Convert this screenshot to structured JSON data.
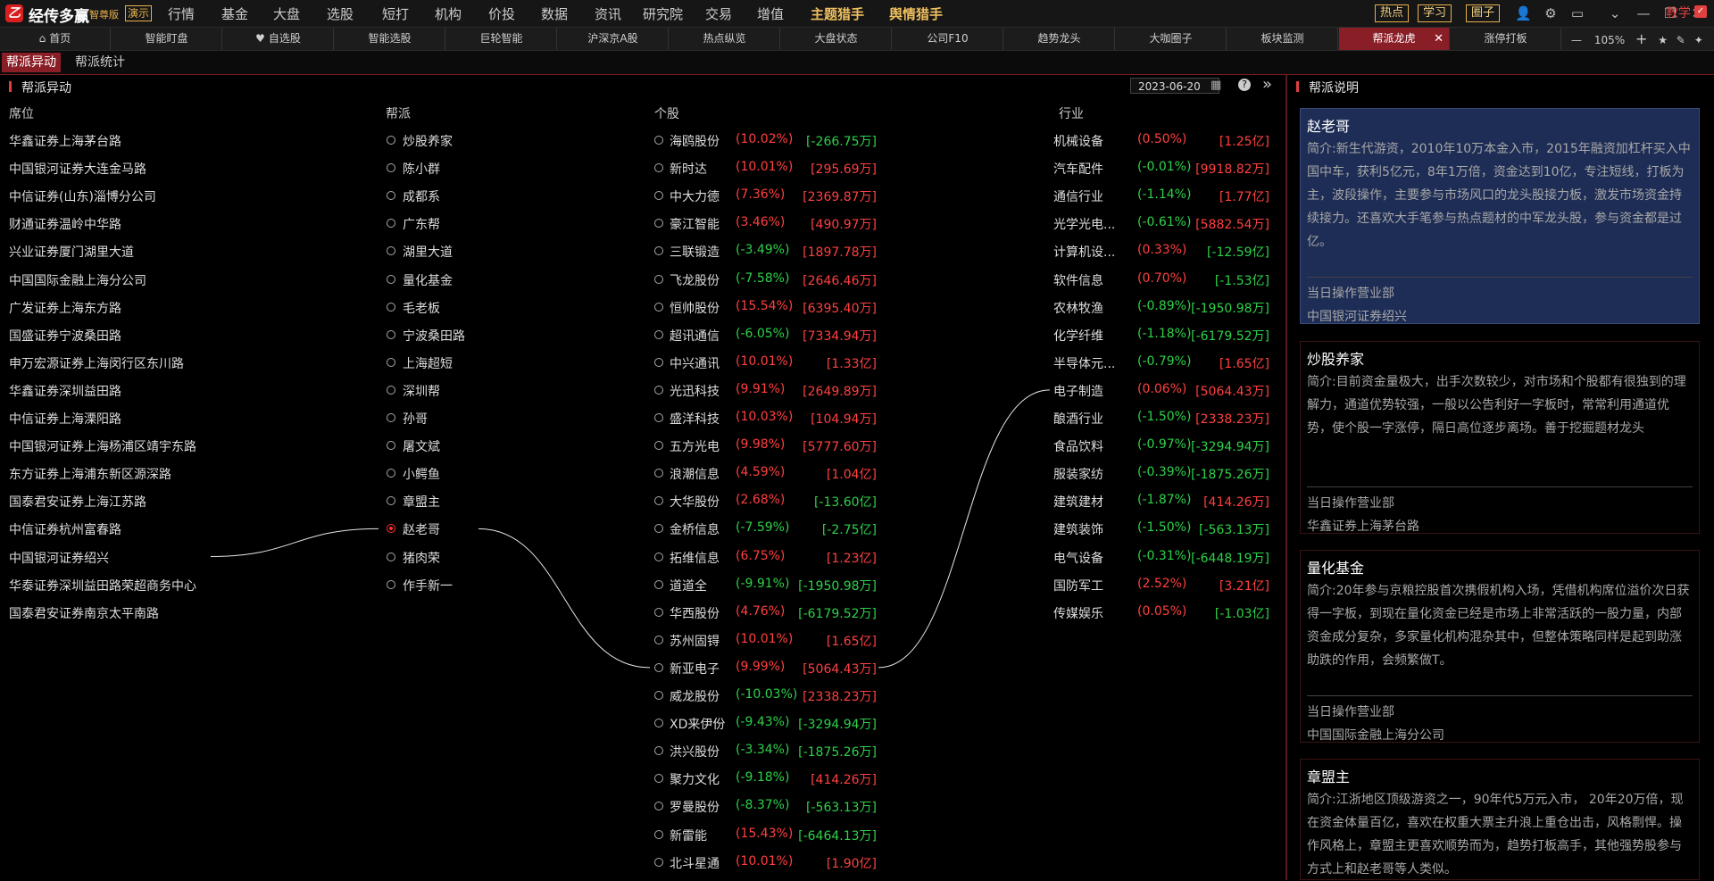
{
  "app": {
    "name": "经传多赢",
    "edition": "智尊版",
    "demo_badge": "演示",
    "menu": [
      {
        "label": "行情",
        "dot": true
      },
      {
        "label": "基金",
        "dot": false
      },
      {
        "label": "大盘",
        "dot": false
      },
      {
        "label": "选股",
        "dot": false
      },
      {
        "label": "短打",
        "dot": false
      },
      {
        "label": "机构",
        "dot": false
      },
      {
        "label": "价投",
        "dot": false
      },
      {
        "label": "数据",
        "dot": false
      },
      {
        "label": "资讯",
        "dot": false
      },
      {
        "label": "研究院",
        "dot": false
      },
      {
        "label": "交易",
        "dot": false
      },
      {
        "label": "增值",
        "dot": true
      },
      {
        "label": "主题猎手",
        "dot": true,
        "gold": true
      },
      {
        "label": "舆情猎手",
        "dot": true,
        "gold": true
      }
    ],
    "right_buttons": [
      "热点",
      "学习",
      "圈子"
    ]
  },
  "tabs": [
    {
      "label": "首页",
      "icon": "home-icon"
    },
    {
      "label": "智能盯盘"
    },
    {
      "label": "自选股",
      "icon": "heart-icon"
    },
    {
      "label": "智能选股"
    },
    {
      "label": "巨轮智能"
    },
    {
      "label": "沪深京A股"
    },
    {
      "label": "热点纵览"
    },
    {
      "label": "大盘状态"
    },
    {
      "label": "公司F10"
    },
    {
      "label": "趋势龙头"
    },
    {
      "label": "大咖圈子"
    },
    {
      "label": "板块监测"
    },
    {
      "label": "帮派龙虎",
      "active": true
    },
    {
      "label": "涨停打板"
    }
  ],
  "zoom": {
    "minus": "—",
    "value": "105%",
    "plus": "+"
  },
  "subtabs": [
    {
      "label": "帮派异动",
      "active": true
    },
    {
      "label": "帮派统计"
    }
  ],
  "teach_label": "教学",
  "left_panel": {
    "title": "帮派异动",
    "date": "2023-06-20",
    "headers": {
      "seat": "席位",
      "gang": "帮派",
      "stock": "个股",
      "industry": "行业"
    }
  },
  "seats": [
    "华鑫证券上海茅台路",
    "中国银河证券大连金马路",
    "中信证券(山东)淄博分公司",
    "财通证券温岭中华路",
    "兴业证券厦门湖里大道",
    "中国国际金融上海分公司",
    "广发证券上海东方路",
    "国盛证券宁波桑田路",
    "申万宏源证券上海闵行区东川路",
    "华鑫证券深圳益田路",
    "中信证券上海溧阳路",
    "中国银河证券上海杨浦区靖宇东路",
    "东方证券上海浦东新区源深路",
    "国泰君安证券上海江苏路",
    "中信证券杭州富春路",
    "中国银河证券绍兴",
    "华泰证券深圳益田路荣超商务中心",
    "国泰君安证券南京太平南路"
  ],
  "gangs": [
    {
      "name": "炒股养家",
      "selected": false
    },
    {
      "name": "陈小群",
      "selected": false
    },
    {
      "name": "成都系",
      "selected": false
    },
    {
      "name": "广东帮",
      "selected": false
    },
    {
      "name": "湖里大道",
      "selected": false
    },
    {
      "name": "量化基金",
      "selected": false
    },
    {
      "name": "毛老板",
      "selected": false
    },
    {
      "name": "宁波桑田路",
      "selected": false
    },
    {
      "name": "上海超短",
      "selected": false
    },
    {
      "name": "深圳帮",
      "selected": false
    },
    {
      "name": "孙哥",
      "selected": false
    },
    {
      "name": "屠文斌",
      "selected": false
    },
    {
      "name": "小鳄鱼",
      "selected": false
    },
    {
      "name": "章盟主",
      "selected": false
    },
    {
      "name": "赵老哥",
      "selected": true
    },
    {
      "name": "猪肉荣",
      "selected": false
    },
    {
      "name": "作手新一",
      "selected": false
    }
  ],
  "stocks": [
    {
      "name": "海鸥股份",
      "pct": "(10.02%)",
      "amt": "[-266.75万]",
      "pc": "red",
      "ac": "green"
    },
    {
      "name": "新时达",
      "pct": "(10.01%)",
      "amt": "[295.69万]",
      "pc": "red",
      "ac": "red"
    },
    {
      "name": "中大力德",
      "pct": "(7.36%)",
      "amt": "[2369.87万]",
      "pc": "red",
      "ac": "red"
    },
    {
      "name": "豪江智能",
      "pct": "(3.46%)",
      "amt": "[490.97万]",
      "pc": "red",
      "ac": "red"
    },
    {
      "name": "三联锻造",
      "pct": "(-3.49%)",
      "amt": "[1897.78万]",
      "pc": "green",
      "ac": "red"
    },
    {
      "name": "飞龙股份",
      "pct": "(-7.58%)",
      "amt": "[2646.46万]",
      "pc": "green",
      "ac": "red"
    },
    {
      "name": "恒帅股份",
      "pct": "(15.54%)",
      "amt": "[6395.40万]",
      "pc": "red",
      "ac": "red"
    },
    {
      "name": "超讯通信",
      "pct": "(-6.05%)",
      "amt": "[7334.94万]",
      "pc": "green",
      "ac": "red"
    },
    {
      "name": "中兴通讯",
      "pct": "(10.01%)",
      "amt": "[1.33亿]",
      "pc": "red",
      "ac": "red"
    },
    {
      "name": "光迅科技",
      "pct": "(9.91%)",
      "amt": "[2649.89万]",
      "pc": "red",
      "ac": "red"
    },
    {
      "name": "盛洋科技",
      "pct": "(10.03%)",
      "amt": "[104.94万]",
      "pc": "red",
      "ac": "red"
    },
    {
      "name": "五方光电",
      "pct": "(9.98%)",
      "amt": "[5777.60万]",
      "pc": "red",
      "ac": "red"
    },
    {
      "name": "浪潮信息",
      "pct": "(4.59%)",
      "amt": "[1.04亿]",
      "pc": "red",
      "ac": "red"
    },
    {
      "name": "大华股份",
      "pct": "(2.68%)",
      "amt": "[-13.60亿]",
      "pc": "red",
      "ac": "green"
    },
    {
      "name": "金桥信息",
      "pct": "(-7.59%)",
      "amt": "[-2.75亿]",
      "pc": "green",
      "ac": "green"
    },
    {
      "name": "拓维信息",
      "pct": "(6.75%)",
      "amt": "[1.23亿]",
      "pc": "red",
      "ac": "red"
    },
    {
      "name": "道道全",
      "pct": "(-9.91%)",
      "amt": "[-1950.98万]",
      "pc": "green",
      "ac": "green"
    },
    {
      "name": "华西股份",
      "pct": "(4.76%)",
      "amt": "[-6179.52万]",
      "pc": "red",
      "ac": "green"
    },
    {
      "name": "苏州固锝",
      "pct": "(10.01%)",
      "amt": "[1.65亿]",
      "pc": "red",
      "ac": "red"
    },
    {
      "name": "新亚电子",
      "pct": "(9.99%)",
      "amt": "[5064.43万]",
      "pc": "red",
      "ac": "red"
    },
    {
      "name": "威龙股份",
      "pct": "(-10.03%)",
      "amt": "[2338.23万]",
      "pc": "green",
      "ac": "red"
    },
    {
      "name": "XD来伊份",
      "pct": "(-9.43%)",
      "amt": "[-3294.94万]",
      "pc": "green",
      "ac": "green"
    },
    {
      "name": "洪兴股份",
      "pct": "(-3.34%)",
      "amt": "[-1875.26万]",
      "pc": "green",
      "ac": "green"
    },
    {
      "name": "聚力文化",
      "pct": "(-9.18%)",
      "amt": "[414.26万]",
      "pc": "green",
      "ac": "red"
    },
    {
      "name": "罗曼股份",
      "pct": "(-8.37%)",
      "amt": "[-563.13万]",
      "pc": "green",
      "ac": "green"
    },
    {
      "name": "新雷能",
      "pct": "(15.43%)",
      "amt": "[-6464.13万]",
      "pc": "red",
      "ac": "green"
    },
    {
      "name": "北斗星通",
      "pct": "(10.01%)",
      "amt": "[1.90亿]",
      "pc": "red",
      "ac": "red"
    }
  ],
  "industries": [
    {
      "name": "机械设备",
      "pct": "(0.50%)",
      "amt": "[1.25亿]",
      "pc": "red",
      "ac": "red"
    },
    {
      "name": "汽车配件",
      "pct": "(-0.01%)",
      "amt": "[9918.82万]",
      "pc": "green",
      "ac": "red"
    },
    {
      "name": "通信行业",
      "pct": "(-1.14%)",
      "amt": "[1.77亿]",
      "pc": "green",
      "ac": "red"
    },
    {
      "name": "光学光电...",
      "pct": "(-0.61%)",
      "amt": "[5882.54万]",
      "pc": "green",
      "ac": "red"
    },
    {
      "name": "计算机设...",
      "pct": "(0.33%)",
      "amt": "[-12.59亿]",
      "pc": "red",
      "ac": "green"
    },
    {
      "name": "软件信息",
      "pct": "(0.70%)",
      "amt": "[-1.53亿]",
      "pc": "red",
      "ac": "green"
    },
    {
      "name": "农林牧渔",
      "pct": "(-0.89%)",
      "amt": "[-1950.98万]",
      "pc": "green",
      "ac": "green"
    },
    {
      "name": "化学纤维",
      "pct": "(-1.18%)",
      "amt": "[-6179.52万]",
      "pc": "green",
      "ac": "green"
    },
    {
      "name": "半导体元...",
      "pct": "(-0.79%)",
      "amt": "[1.65亿]",
      "pc": "green",
      "ac": "red"
    },
    {
      "name": "电子制造",
      "pct": "(0.06%)",
      "amt": "[5064.43万]",
      "pc": "red",
      "ac": "red"
    },
    {
      "name": "酿酒行业",
      "pct": "(-1.50%)",
      "amt": "[2338.23万]",
      "pc": "green",
      "ac": "red"
    },
    {
      "name": "食品饮料",
      "pct": "(-0.97%)",
      "amt": "[-3294.94万]",
      "pc": "green",
      "ac": "green"
    },
    {
      "name": "服装家纺",
      "pct": "(-0.39%)",
      "amt": "[-1875.26万]",
      "pc": "green",
      "ac": "green"
    },
    {
      "name": "建筑建材",
      "pct": "(-1.87%)",
      "amt": "[414.26万]",
      "pc": "green",
      "ac": "red"
    },
    {
      "name": "建筑装饰",
      "pct": "(-1.50%)",
      "amt": "[-563.13万]",
      "pc": "green",
      "ac": "green"
    },
    {
      "name": "电气设备",
      "pct": "(-0.31%)",
      "amt": "[-6448.19万]",
      "pc": "green",
      "ac": "green"
    },
    {
      "name": "国防军工",
      "pct": "(2.52%)",
      "amt": "[3.21亿]",
      "pc": "red",
      "ac": "red"
    },
    {
      "name": "传媒娱乐",
      "pct": "(0.05%)",
      "amt": "[-1.03亿]",
      "pc": "red",
      "ac": "green"
    }
  ],
  "links": {
    "seat_index": 15,
    "gang_index": 14,
    "stock_index": 19,
    "industry_index": 9
  },
  "right_panel": {
    "title": "帮派说明",
    "cards": [
      {
        "name": "赵老哥",
        "intro": "简介:新生代游资，2010年10万本金入市，2015年融资加杠杆买入中国中车，获利5亿元，8年1万倍，资金达到10亿，专注短线，打板为主，波段操作，主要参与市场风口的龙头股接力板，激发市场资金持续接力。还喜欢大手笔参与热点题材的中军龙头股，参与资金都是过亿。",
        "dept_label": "当日操作营业部",
        "dept": "中国银河证券绍兴",
        "selected": true
      },
      {
        "name": "炒股养家",
        "intro": "简介:目前资金量极大，出手次数较少，对市场和个股都有很独到的理解力，通道优势较强，一般以公告利好一字板时，常常利用通道优势，使个股一字涨停，隔日高位逐步离场。善于挖掘题材龙头",
        "dept_label": "当日操作营业部",
        "dept": "华鑫证券上海茅台路",
        "selected": false
      },
      {
        "name": "量化基金",
        "intro": "简介:20年参与京粮控股首次携假机构入场，凭借机构席位溢价次日获得一字板，到现在量化资金已经是市场上非常活跃的一股力量，内部资金成分复杂，多家量化机构混杂其中，但整体策略同样是起到助涨助跌的作用，会频繁做T。",
        "dept_label": "当日操作营业部",
        "dept": "中国国际金融上海分公司",
        "selected": false
      },
      {
        "name": "章盟主",
        "intro": "简介:江浙地区顶级游资之一，90年代5万元入市， 20年20万倍，现在资金体量百亿，喜欢在权重大票主升浪上重仓出击，风格剽悍。操作风格上，章盟主更喜欢顺势而为，趋势打板高手，其他强势股参与方式上和赵老哥等人类似。",
        "dept_label": "",
        "dept": "",
        "selected": false
      }
    ]
  },
  "colors": {
    "accent": "#8a1e26",
    "up": "#ff4040",
    "down": "#2ed14a",
    "selected_card": "#1e2d55"
  }
}
